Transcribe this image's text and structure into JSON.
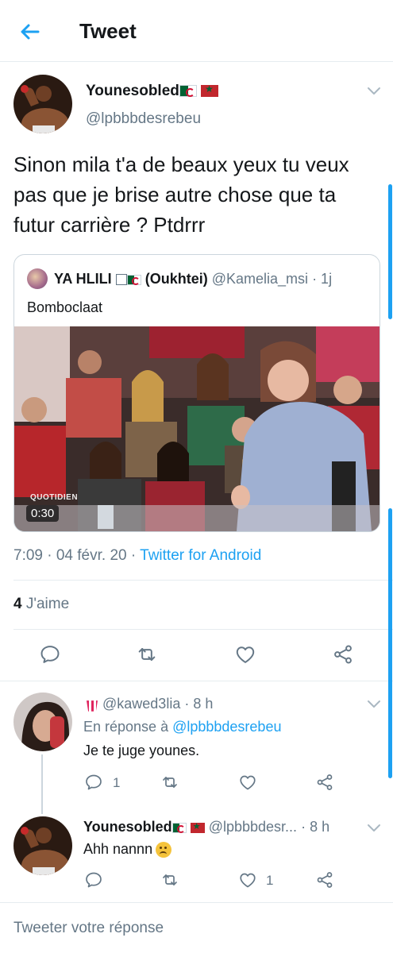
{
  "header": {
    "title": "Tweet"
  },
  "main_tweet": {
    "display_name": "Younesobled",
    "handle": "@lpbbbdesrebeu",
    "text": "Sinon mila t'a de beaux yeux tu veux pas que je brise autre chose que ta futur carrière ? Ptdrrr",
    "quoted": {
      "display_name": "YA HLILI",
      "name_suffix": "(Oukhtei)",
      "handle": "@Kamelia_msi",
      "time": "· 1j",
      "text": "Bomboclaat",
      "video_duration": "0:30",
      "media_logo": "QUOTIDIEN"
    },
    "time": "7:09 · 04 févr. 20 ·",
    "source": "Twitter for Android",
    "likes_count": "4",
    "likes_label": "J'aime"
  },
  "replies": [
    {
      "handle": "@kawed3lia",
      "time": "· 8 h",
      "reply_prefix": "En réponse à",
      "reply_to": "@lpbbbdesrebeu",
      "text": "Je te juge younes.",
      "reply_count": "1",
      "like_count": ""
    },
    {
      "display_name": "Younesobled",
      "handle": "@lpbbbdesr...",
      "time": "· 8 h",
      "text": "Ahh nannn",
      "reply_count": "",
      "like_count": "1"
    }
  ],
  "composer": {
    "placeholder": "Tweeter votre réponse"
  },
  "colors": {
    "accent": "#1da1f2",
    "text": "#14171a",
    "secondary": "#657786",
    "border": "#e6ecf0"
  },
  "icons": [
    "back-arrow-icon",
    "chevron-down-icon",
    "reply-icon",
    "retweet-icon",
    "like-icon",
    "share-icon",
    "popcorn-emoji",
    "worried-face-emoji",
    "algeria-flag",
    "morocco-flag"
  ]
}
